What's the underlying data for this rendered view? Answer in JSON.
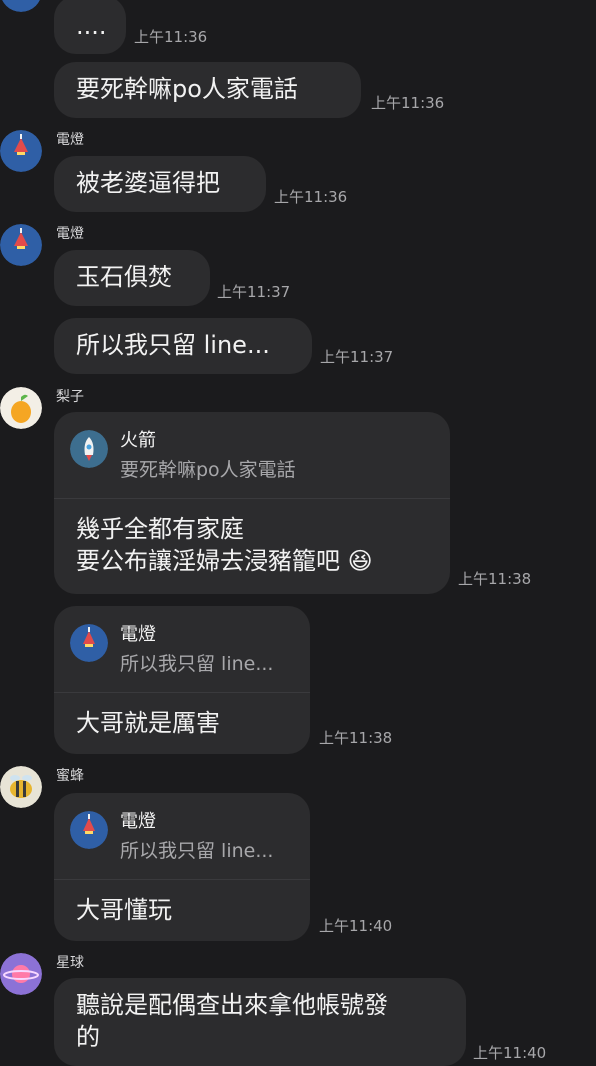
{
  "messages": [
    {
      "text": "....",
      "time": "上午11:36"
    },
    {
      "text": "要死幹嘛po人家電話",
      "time": "上午11:36"
    },
    {
      "sender": "電燈",
      "text": "被老婆逼得把",
      "time": "上午11:36"
    },
    {
      "sender": "電燈",
      "text": "玉石俱焚",
      "time": "上午11:37"
    },
    {
      "text": "所以我只留 line...",
      "time": "上午11:37"
    },
    {
      "sender": "梨子",
      "quote_name": "火箭",
      "quote_text": "要死幹嘛po人家電話",
      "text": "幾乎全都有家庭\n要公布讓淫婦去浸豬籠吧 😆",
      "time": "上午11:38"
    },
    {
      "quote_name": "電燈",
      "quote_text": "所以我只留 line...",
      "text": "大哥就是厲害",
      "time": "上午11:38"
    },
    {
      "sender": "蜜蜂",
      "quote_name": "電燈",
      "quote_text": "所以我只留 line...",
      "text": "大哥懂玩",
      "time": "上午11:40"
    },
    {
      "sender": "星球",
      "text": "聽說是配偶查出來拿他帳號發\n的",
      "time": "上午11:40"
    }
  ],
  "colors": {
    "background": "#1b1b1d",
    "bubble": "#2c2c2e",
    "text": "#f2f2f2",
    "muted": "#a7a7aa"
  },
  "icons": [
    "lamp-avatar-icon",
    "pear-avatar-icon",
    "rocket-avatar-icon",
    "bee-avatar-icon",
    "planet-avatar-icon"
  ]
}
